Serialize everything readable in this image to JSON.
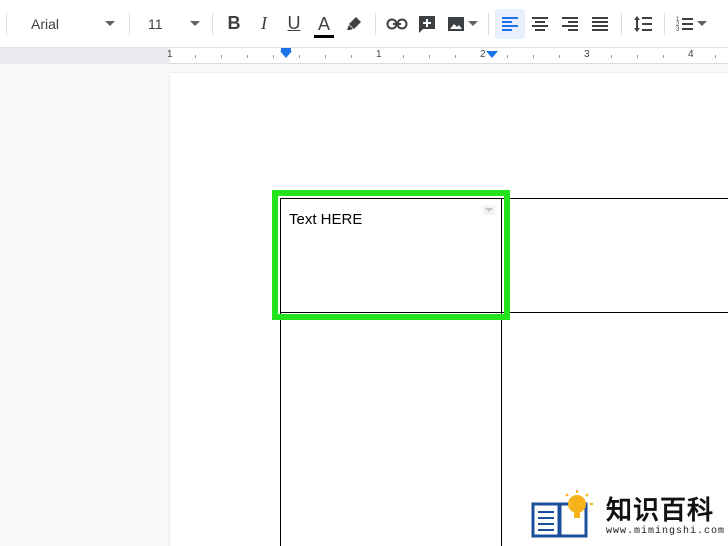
{
  "toolbar": {
    "font": "Arial",
    "size": "11",
    "bold_label": "B",
    "italic_label": "I",
    "underline_label": "U",
    "text_color_label": "A",
    "text_color": "#000000",
    "icons": [
      "highlight-icon",
      "link-icon",
      "add-comment-icon",
      "insert-image-icon",
      "align-left-icon",
      "align-center-icon",
      "align-right-icon",
      "justify-icon",
      "line-spacing-icon",
      "numbered-list-icon"
    ],
    "active_alignment": "left"
  },
  "ruler": {
    "labels": [
      "1",
      "1",
      "2",
      "3",
      "4"
    ]
  },
  "document": {
    "table": {
      "rows": [
        [
          "Text HERE",
          ""
        ],
        [
          "",
          ""
        ]
      ],
      "selected_cell": "row1-col1",
      "highlight_color": "#22e41a"
    }
  },
  "watermark": {
    "title": "知识百科",
    "url": "www.mimingshi.com"
  }
}
